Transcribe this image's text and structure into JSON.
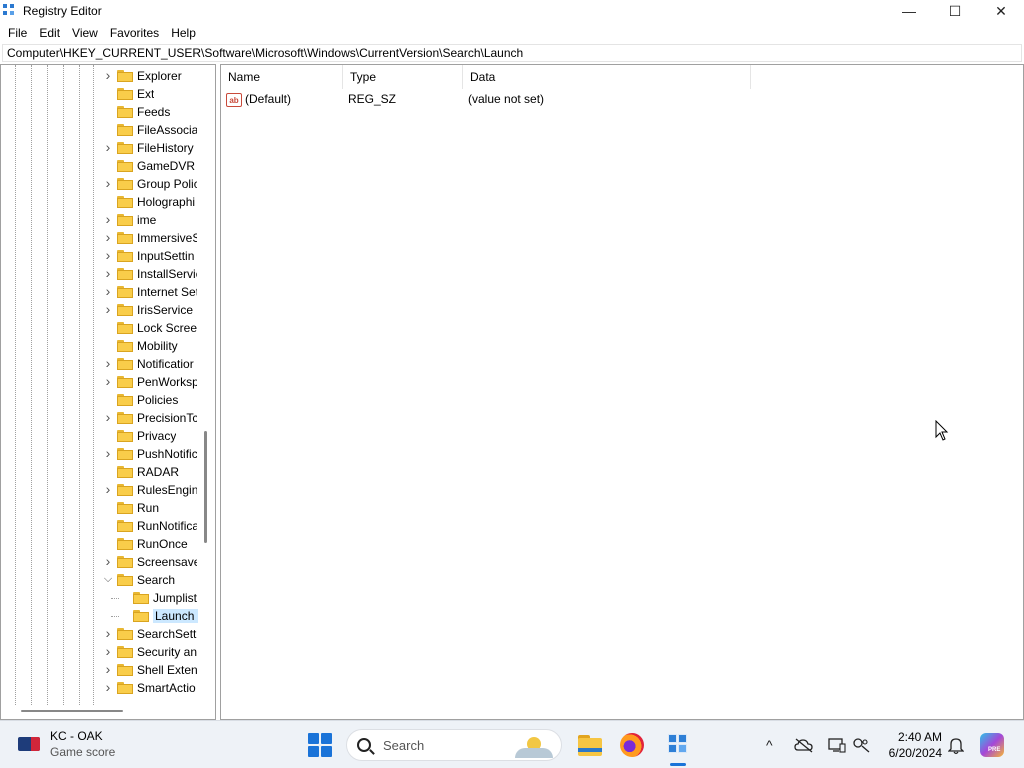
{
  "window": {
    "title": "Registry Editor",
    "controls": {
      "minimize": "—",
      "maximize": "☐",
      "close": "✕"
    }
  },
  "menu": [
    "File",
    "Edit",
    "View",
    "Favorites",
    "Help"
  ],
  "address": "Computer\\HKEY_CURRENT_USER\\Software\\Microsoft\\Windows\\CurrentVersion\\Search\\Launch",
  "tree": {
    "items": [
      {
        "label": "Explorer",
        "expander": ">",
        "level": 1
      },
      {
        "label": "Ext",
        "expander": "",
        "level": 1
      },
      {
        "label": "Feeds",
        "expander": "",
        "level": 1
      },
      {
        "label": "FileAssociat",
        "expander": "",
        "level": 1
      },
      {
        "label": "FileHistory",
        "expander": ">",
        "level": 1
      },
      {
        "label": "GameDVR",
        "expander": "",
        "level": 1
      },
      {
        "label": "Group Polic",
        "expander": ">",
        "level": 1
      },
      {
        "label": "Holographi",
        "expander": "",
        "level": 1
      },
      {
        "label": "ime",
        "expander": ">",
        "level": 1
      },
      {
        "label": "ImmersiveS",
        "expander": ">",
        "level": 1
      },
      {
        "label": "InputSettin",
        "expander": ">",
        "level": 1
      },
      {
        "label": "InstallServic",
        "expander": ">",
        "level": 1
      },
      {
        "label": "Internet Set",
        "expander": ">",
        "level": 1
      },
      {
        "label": "IrisService",
        "expander": ">",
        "level": 1
      },
      {
        "label": "Lock Screer",
        "expander": "",
        "level": 1
      },
      {
        "label": "Mobility",
        "expander": "",
        "level": 1
      },
      {
        "label": "Notificatior",
        "expander": ">",
        "level": 1
      },
      {
        "label": "PenWorksp",
        "expander": ">",
        "level": 1
      },
      {
        "label": "Policies",
        "expander": "",
        "level": 1
      },
      {
        "label": "PrecisionTc",
        "expander": ">",
        "level": 1
      },
      {
        "label": "Privacy",
        "expander": "",
        "level": 1
      },
      {
        "label": "PushNotific",
        "expander": ">",
        "level": 1
      },
      {
        "label": "RADAR",
        "expander": "",
        "level": 1
      },
      {
        "label": "RulesEngin",
        "expander": ">",
        "level": 1
      },
      {
        "label": "Run",
        "expander": "",
        "level": 1
      },
      {
        "label": "RunNotifica",
        "expander": "",
        "level": 1
      },
      {
        "label": "RunOnce",
        "expander": "",
        "level": 1
      },
      {
        "label": "Screensave",
        "expander": ">",
        "level": 1
      },
      {
        "label": "Search",
        "expander": "v",
        "level": 1
      },
      {
        "label": "Jumplist",
        "expander": "",
        "level": 2
      },
      {
        "label": "Launch",
        "expander": "",
        "level": 2,
        "selected": true
      },
      {
        "label": "SearchSetti",
        "expander": ">",
        "level": 1
      },
      {
        "label": "Security an",
        "expander": ">",
        "level": 1
      },
      {
        "label": "Shell Extens",
        "expander": ">",
        "level": 1
      },
      {
        "label": "SmartActio",
        "expander": ">",
        "level": 1
      }
    ]
  },
  "list": {
    "columns": [
      "Name",
      "Type",
      "Data"
    ],
    "rows": [
      {
        "icon": "ab",
        "name": "(Default)",
        "type": "REG_SZ",
        "data": "(value not set)"
      }
    ]
  },
  "taskbar": {
    "widget": {
      "title": "KC - OAK",
      "subtitle": "Game score",
      "icon": "mlb-icon"
    },
    "search_placeholder": "Search",
    "clock": {
      "time": "2:40 AM",
      "date": "6/20/2024"
    },
    "tray_icons": [
      "chevron-up-icon",
      "onedrive-offline-icon",
      "display-icon",
      "location-icon",
      "bell-icon"
    ],
    "copilot_badge": "PRE"
  }
}
